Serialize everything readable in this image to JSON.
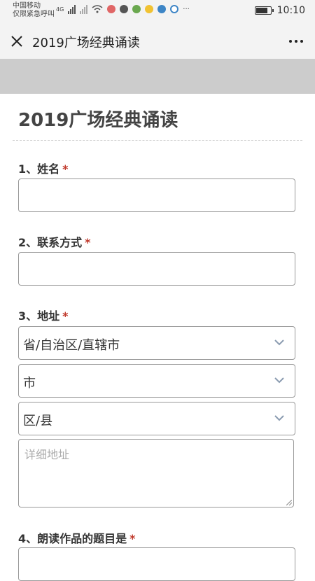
{
  "status_bar": {
    "carrier_line1": "中国移动",
    "carrier_line2": "仅限紧急呼叫",
    "network": "4G",
    "overflow": "···",
    "time": "10:10"
  },
  "nav": {
    "title": "2019广场经典诵读",
    "close_icon": "close-icon",
    "more_icon": "more-icon"
  },
  "form": {
    "title": "2019广场经典诵读",
    "required_mark": "*",
    "questions": [
      {
        "label": "1、姓名"
      },
      {
        "label": "2、联系方式"
      },
      {
        "label": "3、地址"
      },
      {
        "label": "4、朗读作品的题目是"
      }
    ],
    "address": {
      "province": "省/自治区/直辖市",
      "city": "市",
      "district": "区/县",
      "detail_placeholder": "详细地址"
    }
  },
  "colors": {
    "header_bg": "#f3f3f3",
    "band": "#cccccc",
    "required": "#c0392b",
    "chevron": "#8a9bb0"
  }
}
